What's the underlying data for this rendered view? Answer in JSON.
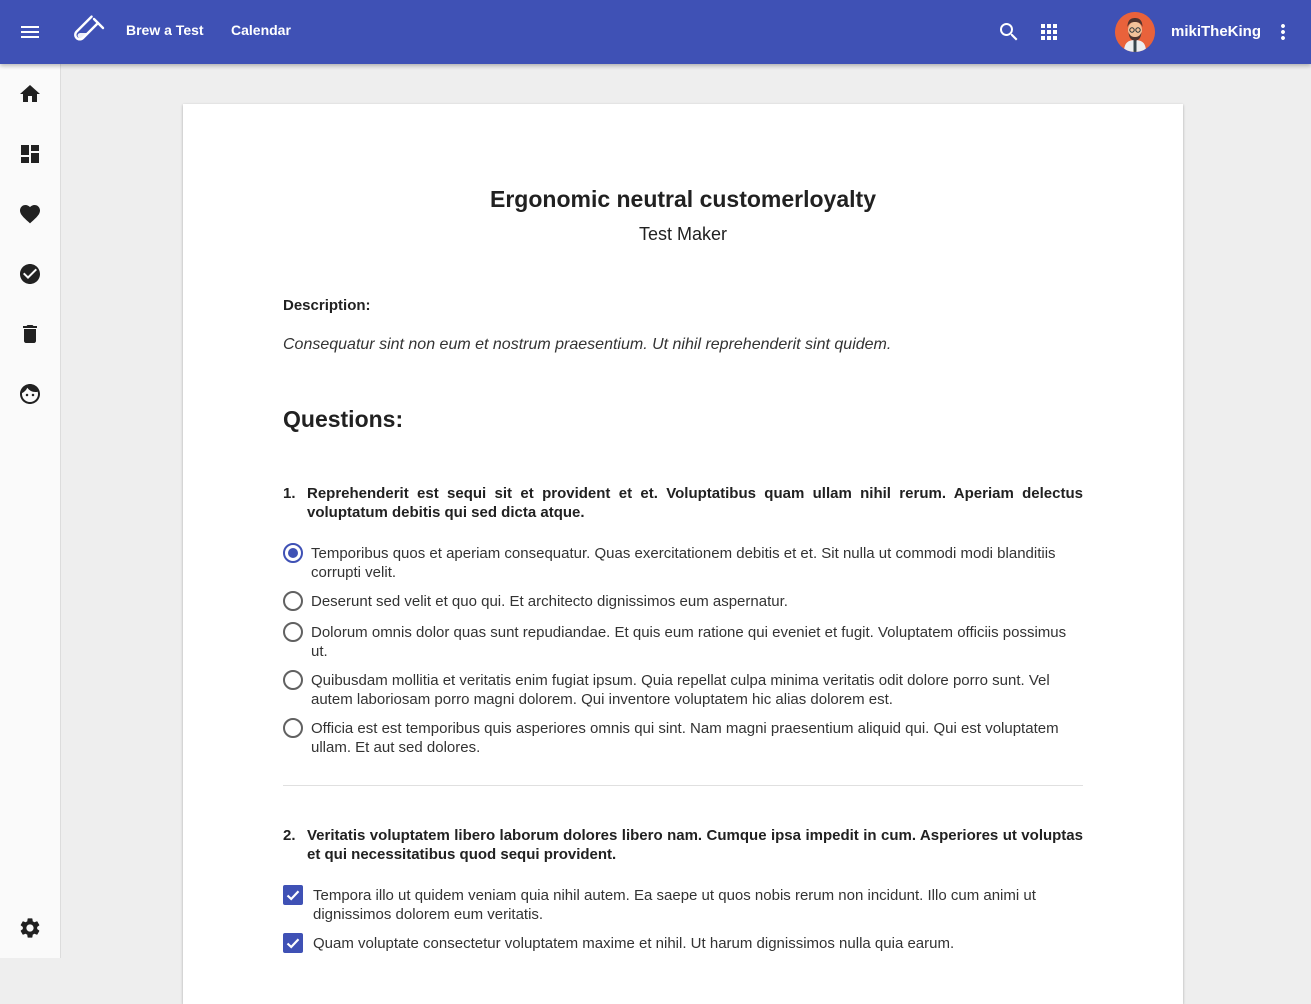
{
  "header": {
    "nav": [
      "Brew a Test",
      "Calendar"
    ],
    "username": "mikiTheKing",
    "brand_color": "#3f51b5"
  },
  "icons": {
    "menu": "menu-icon",
    "logo": "test-tube-icon",
    "search": "search-icon",
    "apps": "apps-grid-icon",
    "more": "more-vert-icon",
    "sidebar": [
      "home-icon",
      "dashboard-icon",
      "heart-icon",
      "check-circle-icon",
      "trash-icon",
      "face-icon",
      "settings-icon"
    ]
  },
  "test": {
    "title": "Ergonomic neutral customerloyalty",
    "author": "Test Maker",
    "description_label": "Description:",
    "description": "Consequatur sint non eum et nostrum praesentium. Ut nihil reprehenderit sint quidem.",
    "questions_heading": "Questions:"
  },
  "questions": [
    {
      "number": "1.",
      "text": "Reprehenderit est sequi sit et provident et et. Voluptatibus quam ullam nihil rerum. Aperiam delectus voluptatum debitis qui sed dicta atque.",
      "type": "radio",
      "options": [
        {
          "text": "Temporibus quos et aperiam consequatur. Quas exercitationem debitis et et. Sit nulla ut commodi modi blanditiis corrupti velit.",
          "selected": true
        },
        {
          "text": "Deserunt sed velit et quo qui. Et architecto dignissimos eum aspernatur.",
          "selected": false
        },
        {
          "text": "Dolorum omnis dolor quas sunt repudiandae. Et quis eum ratione qui eveniet et fugit. Voluptatem officiis possimus ut.",
          "selected": false
        },
        {
          "text": "Quibusdam mollitia et veritatis enim fugiat ipsum. Quia repellat culpa minima veritatis odit dolore porro sunt. Vel autem laboriosam porro magni dolorem. Qui inventore voluptatem hic alias dolorem est.",
          "selected": false
        },
        {
          "text": "Officia est est temporibus quis asperiores omnis qui sint. Nam magni praesentium aliquid qui. Qui est voluptatem ullam. Et aut sed dolores.",
          "selected": false
        }
      ]
    },
    {
      "number": "2.",
      "text": "Veritatis voluptatem libero laborum dolores libero nam. Cumque ipsa impedit in cum. Asperiores ut voluptas et qui necessitatibus quod sequi provident.",
      "type": "checkbox",
      "options": [
        {
          "text": "Tempora illo ut quidem veniam quia nihil autem. Ea saepe ut quos nobis rerum non incidunt. Illo cum animi ut dignissimos dolorem eum veritatis.",
          "selected": true
        },
        {
          "text": "Quam voluptate consectetur voluptatem maxime et nihil. Ut harum dignissimos nulla quia earum.",
          "selected": true
        }
      ]
    }
  ]
}
